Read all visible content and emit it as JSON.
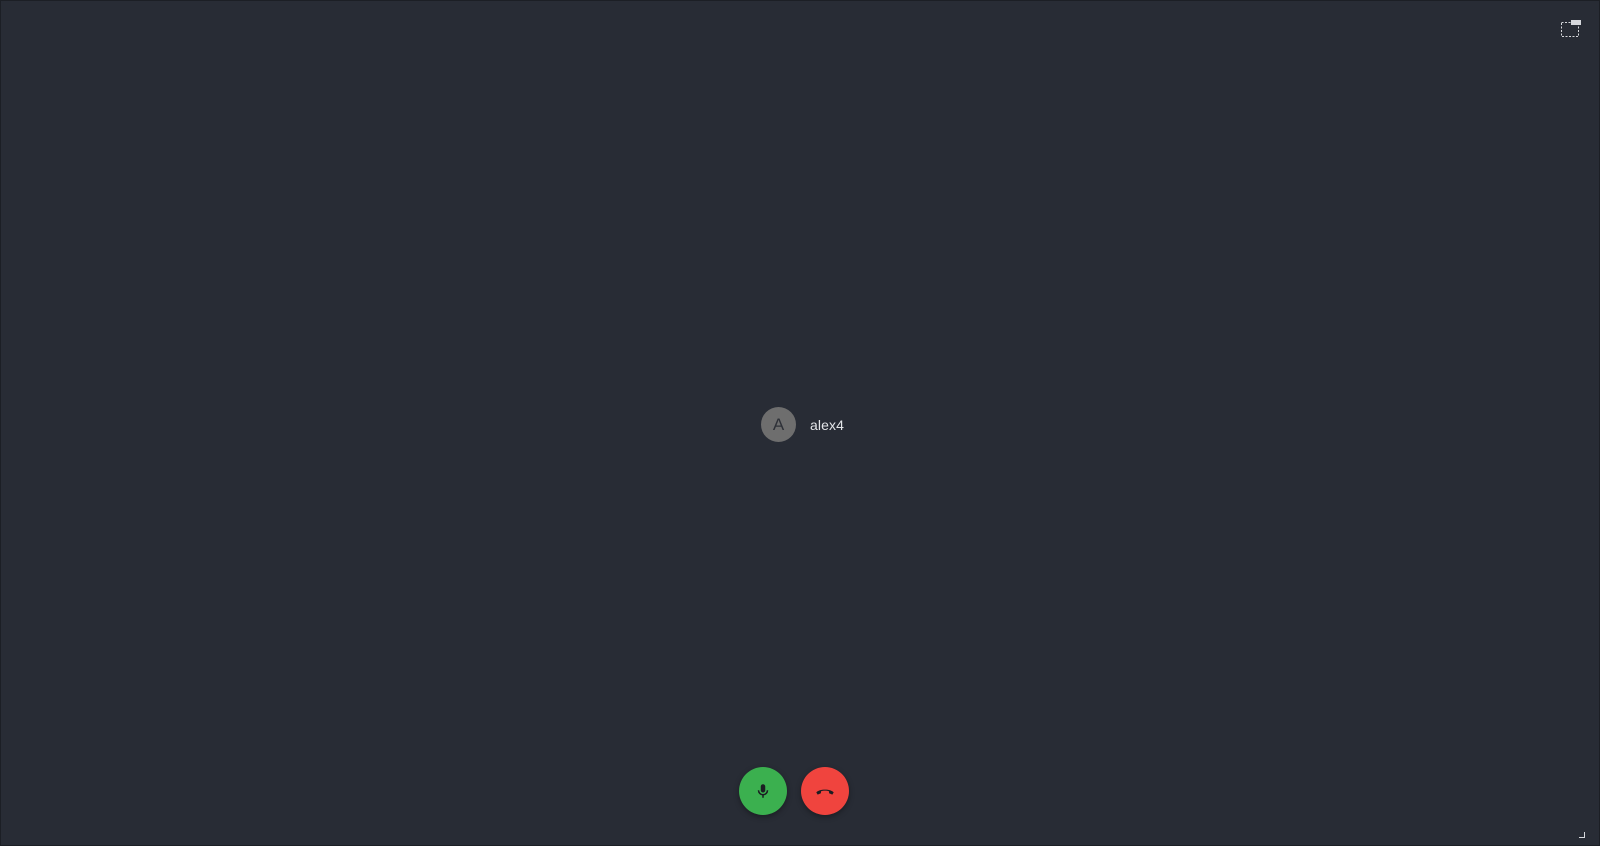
{
  "participant": {
    "avatar_initial": "A",
    "name": "alex4"
  },
  "controls": {
    "mic_icon": "microphone-icon",
    "hangup_icon": "phone-hangup-icon",
    "pip_icon": "picture-in-picture-icon"
  },
  "colors": {
    "background": "#282c35",
    "mic": "#3bb04f",
    "hangup": "#f0443e",
    "avatar": "#6e6e6e"
  }
}
